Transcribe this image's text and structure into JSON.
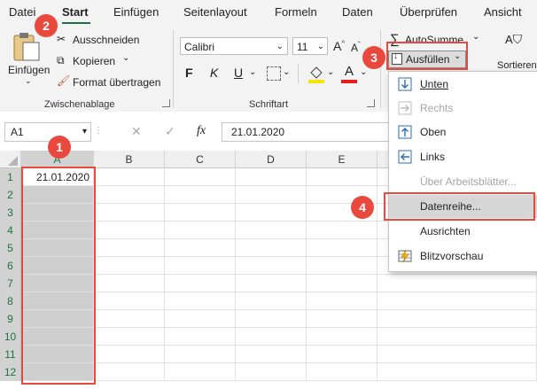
{
  "tabs": [
    "Datei",
    "Start",
    "Einfügen",
    "Seitenlayout",
    "Formeln",
    "Daten",
    "Überprüfen",
    "Ansicht"
  ],
  "clipboard": {
    "paste_label": "Einfügen",
    "cut_label": "Ausschneiden",
    "copy_label": "Kopieren",
    "format_painter_label": "Format übertragen",
    "group_label": "Zwischenablage"
  },
  "font": {
    "font_name": "Calibri",
    "font_size": "11",
    "bold": "F",
    "italic": "K",
    "underline": "U",
    "font_color_glyph": "A",
    "group_label": "Schriftart"
  },
  "editing": {
    "autosum_label": "AutoSumme",
    "fill_label": "Ausfüllen",
    "sort_label": "Sortieren u"
  },
  "formula_bar": {
    "name_box": "A1",
    "fx": "fx",
    "value": "21.01.2020"
  },
  "grid": {
    "columns": [
      "A",
      "B",
      "C",
      "D",
      "E"
    ],
    "rows": [
      "1",
      "2",
      "3",
      "4",
      "5",
      "6",
      "7",
      "8",
      "9",
      "10",
      "11",
      "12"
    ],
    "a1_value": "21.01.2020"
  },
  "fill_menu": {
    "items": [
      {
        "label": "Unten",
        "icon": "arrow-down-icon",
        "enabled": true
      },
      {
        "label": "Rechts",
        "icon": "arrow-right-icon",
        "enabled": false
      },
      {
        "label": "Oben",
        "icon": "arrow-up-icon",
        "enabled": true
      },
      {
        "label": "Links",
        "icon": "arrow-left-icon",
        "enabled": true
      },
      {
        "label": "Über Arbeitsblätter...",
        "icon": "",
        "enabled": false
      },
      {
        "label": "Datenreihe...",
        "icon": "",
        "enabled": true
      },
      {
        "label": "Ausrichten",
        "icon": "",
        "enabled": true
      },
      {
        "label": "Blitzvorschau",
        "icon": "flash-fill-icon",
        "enabled": true
      }
    ]
  },
  "callouts": [
    "1",
    "2",
    "3",
    "4"
  ],
  "colors": {
    "accent_green": "#1e7145",
    "callout_red": "#e8493c",
    "selection_gray": "#cfcfcf"
  }
}
